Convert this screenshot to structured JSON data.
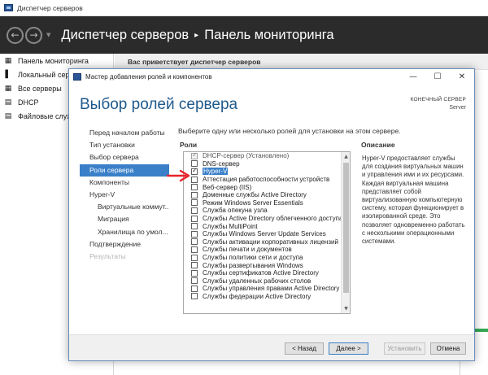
{
  "app": {
    "title": "Диспетчер серверов",
    "breadcrumb_root": "Диспетчер серверов",
    "breadcrumb_sep": "▸",
    "breadcrumb_page": "Панель мониторинга"
  },
  "nav": {
    "back_icon": "←",
    "forward_icon": "→",
    "dropdown_icon": "▼"
  },
  "sidebar": {
    "items": [
      {
        "label": "Панель мониторинга",
        "icon": "▦",
        "active": true
      },
      {
        "label": "Локальный сервер",
        "icon": "▌",
        "active": false
      },
      {
        "label": "Все серверы",
        "icon": "▦",
        "active": false
      },
      {
        "label": "DHCP",
        "icon": "▤",
        "active": false
      },
      {
        "label": "Файловые службы",
        "icon": "▤",
        "active": false
      }
    ]
  },
  "main": {
    "welcome": "Вас приветствует диспетчер серверов"
  },
  "wizard": {
    "title": "Мастер добавления ролей и компонентов",
    "controls": {
      "minimize": "—",
      "maximize": "☐",
      "close": "✕"
    },
    "heading": "Выбор ролей сервера",
    "target_label": "КОНЕЧНЫЙ СЕРВЕР",
    "target_value": "Server",
    "instruction": "Выберите одну или несколько ролей для установки на этом сервере.",
    "roles_label": "Роли",
    "description_label": "Описание",
    "description": "Hyper-V предоставляет службы для создания виртуальных машин и управления ими и их ресурсами. Каждая виртуальная машина представляет собой виртуализованную компьютерную систему, которая функционирует в изолированной среде. Это позволяет одновременно работать с несколькими операционными системами.",
    "steps": [
      {
        "label": "Перед началом работы",
        "level": 0,
        "state": "normal"
      },
      {
        "label": "Тип установки",
        "level": 0,
        "state": "normal"
      },
      {
        "label": "Выбор сервера",
        "level": 0,
        "state": "normal"
      },
      {
        "label": "Роли сервера",
        "level": 0,
        "state": "active"
      },
      {
        "label": "Компоненты",
        "level": 0,
        "state": "normal"
      },
      {
        "label": "Hyper-V",
        "level": 0,
        "state": "normal"
      },
      {
        "label": "Виртуальные коммут...",
        "level": 1,
        "state": "normal"
      },
      {
        "label": "Миграция",
        "level": 1,
        "state": "normal"
      },
      {
        "label": "Хранилища по умол...",
        "level": 1,
        "state": "normal"
      },
      {
        "label": "Подтверждение",
        "level": 0,
        "state": "normal"
      },
      {
        "label": "Результаты",
        "level": 0,
        "state": "disabled"
      }
    ],
    "roles": [
      {
        "label": "DHCP-сервер (Установлено)",
        "checked": true,
        "disabled": true,
        "selected": false
      },
      {
        "label": "DNS-сервер",
        "checked": false,
        "disabled": false,
        "selected": false
      },
      {
        "label": "Hyper-V",
        "checked": true,
        "disabled": false,
        "selected": true
      },
      {
        "label": "Аттестация работоспособности устройств",
        "checked": false,
        "disabled": false,
        "selected": false
      },
      {
        "label": "Веб-сервер (IIS)",
        "checked": false,
        "disabled": false,
        "selected": false
      },
      {
        "label": "Доменные службы Active Directory",
        "checked": false,
        "disabled": false,
        "selected": false
      },
      {
        "label": "Режим Windows Server Essentials",
        "checked": false,
        "disabled": false,
        "selected": false
      },
      {
        "label": "Служба опекуна узла",
        "checked": false,
        "disabled": false,
        "selected": false
      },
      {
        "label": "Службы Active Directory облегченного доступа к",
        "checked": false,
        "disabled": false,
        "selected": false
      },
      {
        "label": "Службы MultiPoint",
        "checked": false,
        "disabled": false,
        "selected": false
      },
      {
        "label": "Службы Windows Server Update Services",
        "checked": false,
        "disabled": false,
        "selected": false
      },
      {
        "label": "Службы активации корпоративных лицензий",
        "checked": false,
        "disabled": false,
        "selected": false
      },
      {
        "label": "Службы печати и документов",
        "checked": false,
        "disabled": false,
        "selected": false
      },
      {
        "label": "Службы политики сети и доступа",
        "checked": false,
        "disabled": false,
        "selected": false
      },
      {
        "label": "Службы развертывания Windows",
        "checked": false,
        "disabled": false,
        "selected": false
      },
      {
        "label": "Службы сертификатов Active Directory",
        "checked": false,
        "disabled": false,
        "selected": false
      },
      {
        "label": "Службы удаленных рабочих столов",
        "checked": false,
        "disabled": false,
        "selected": false
      },
      {
        "label": "Службы управления правами Active Directory",
        "checked": false,
        "disabled": false,
        "selected": false
      },
      {
        "label": "Службы федерации Active Directory",
        "checked": false,
        "disabled": false,
        "selected": false
      }
    ],
    "scroll": {
      "up": "▲",
      "down": "▼"
    },
    "buttons": {
      "back": "< Назад",
      "next": "Далее >",
      "install": "Установить",
      "cancel": "Отмена"
    },
    "arrow_color": "#e8232a"
  }
}
